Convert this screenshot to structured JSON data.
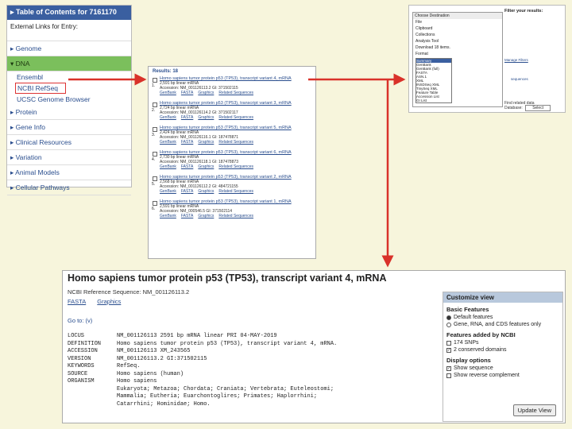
{
  "left": {
    "toc": "▸ Table of Contents for 7161170",
    "external": "External Links for Entry:",
    "sections": [
      {
        "label": "▸ Genome"
      },
      {
        "label": "▾ DNA",
        "active": true,
        "subs": [
          "Ensembl",
          "NCBI RefSeq",
          "UCSC Genome Browser"
        ]
      },
      {
        "label": "▸ Protein"
      },
      {
        "label": "▸ Gene Info"
      },
      {
        "label": "▸ Clinical Resources"
      },
      {
        "label": "▸ Variation"
      },
      {
        "label": "▸ Animal Models"
      },
      {
        "label": "▸ Cellular Pathways"
      }
    ]
  },
  "results": {
    "header": "Results: 18",
    "items": [
      {
        "num": "1.",
        "title": "Homo sapiens tumor protein p53 (TP53), transcript variant 4, mRNA",
        "len": "2,591 bp linear mRNA",
        "acc": "Accession: NM_001126113.2   GI: 371502115"
      },
      {
        "num": "2.",
        "title": "Homo sapiens tumor protein p53 (TP53), transcript variant 3, mRNA",
        "len": "2,724 bp linear mRNA",
        "acc": "Accession: NM_001126114.2   GI: 371502117"
      },
      {
        "num": "3.",
        "title": "Homo sapiens tumor protein p53 (TP53), transcript variant 5, mRNA",
        "len": "2,424 bp linear mRNA",
        "acc": "Accession: NM_001126116.1   GI: 187478871"
      },
      {
        "num": "4.",
        "title": "Homo sapiens tumor protein p53 (TP53), transcript variant 6, mRNA",
        "len": "2,730 bp linear mRNA",
        "acc": "Accession: NM_001126118.1   GI: 187478873"
      },
      {
        "num": "5.",
        "title": "Homo sapiens tumor protein p53 (TP53), transcript variant 2, mRNA",
        "len": "2,568 bp linear mRNA",
        "acc": "Accession: NM_001126112.2   GI: 484721155"
      },
      {
        "num": "6.",
        "title": "Homo sapiens tumor protein p53 (TP53), transcript variant 1, mRNA",
        "len": "2,591 bp linear mRNA",
        "acc": "Accession: NM_000546.5   GI: 371502114"
      }
    ],
    "links": [
      "GenBank",
      "FASTA",
      "Graphics",
      "Related Sequences"
    ]
  },
  "topright": {
    "dialog_title": "Choose Destination",
    "destinations": [
      "File",
      "Clipboard",
      "Collections",
      "Analysis Tool"
    ],
    "download": "Download 18 items.",
    "format_label": "Format",
    "formats": [
      "Summary",
      "GenBank",
      "GenBank (full)",
      "FASTA",
      "ASN.1",
      "XML",
      "INSDSeq XML",
      "TinySeq XML",
      "Feature Table",
      "Accession List",
      "GI List"
    ],
    "filter": "Filter your results:",
    "provider": "Manage Filters",
    "seq": "sequences",
    "find": "Find related data",
    "db_label": "Database:",
    "db_value": "Select"
  },
  "detail": {
    "title": "Homo sapiens tumor protein p53 (TP53), transcript variant 4, mRNA",
    "ref": "NCBI Reference Sequence: NM_001126113.2",
    "links": [
      "FASTA",
      "Graphics"
    ],
    "goto": "Go to: (v)",
    "record": [
      {
        "k": "LOCUS",
        "v": "NM_001126113           2591 bp    mRNA    linear   PRI 04-MAY-2019"
      },
      {
        "k": "DEFINITION",
        "v": "Homo sapiens tumor protein p53 (TP53), transcript variant 4, mRNA."
      },
      {
        "k": "ACCESSION",
        "v": "NM_001126113 XM_243565"
      },
      {
        "k": "VERSION",
        "v": "NM_001126113.2  GI:371502115"
      },
      {
        "k": "KEYWORDS",
        "v": "RefSeq."
      },
      {
        "k": "SOURCE",
        "v": "Homo sapiens (human)"
      },
      {
        "k": "  ORGANISM",
        "v": "Homo sapiens"
      },
      {
        "k": "",
        "v": "Eukaryota; Metazoa; Chordata; Craniata; Vertebrata; Euteleostomi;"
      },
      {
        "k": "",
        "v": "Mammalia; Eutheria; Euarchontoglires; Primates; Haplorrhini;"
      },
      {
        "k": "",
        "v": "Catarrhini; Hominidae; Homo."
      }
    ],
    "customize": {
      "header": "Customize view",
      "basic": "Basic Features",
      "basic_opts": [
        {
          "label": "Default features",
          "on": true
        },
        {
          "label": "Gene, RNA, and CDS features only",
          "on": false
        }
      ],
      "added": "Features added by NCBI",
      "added_opts": [
        {
          "label": "174 SNPs",
          "on": false
        },
        {
          "label": "2 conserved domains",
          "on": true
        }
      ],
      "display": "Display options",
      "display_opts": [
        {
          "label": "Show sequence",
          "on": true
        },
        {
          "label": "Show reverse complement",
          "on": false
        }
      ],
      "button": "Update View"
    }
  },
  "colors": {
    "arrow": "#d9322a",
    "link": "#2a4e8e",
    "active": "#7bbf5c"
  }
}
